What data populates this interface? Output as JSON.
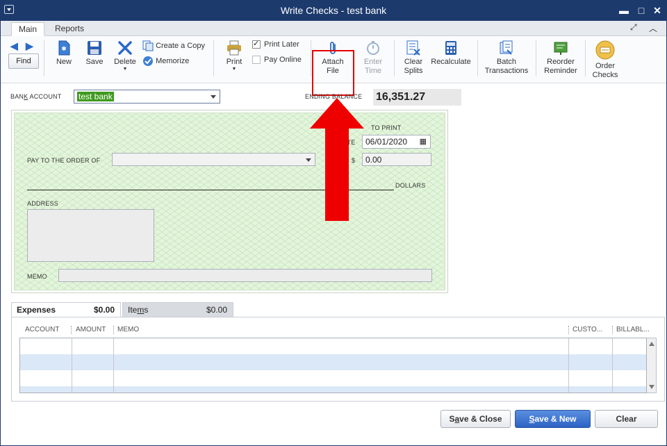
{
  "window": {
    "title": "Write Checks - test bank",
    "controls": {
      "minimize": "▬",
      "maximize": "□",
      "close": "✕"
    }
  },
  "ribbon": {
    "tabs": [
      "Main",
      "Reports"
    ],
    "active_tab": "Main"
  },
  "toolbar": {
    "find": "Find",
    "new": "New",
    "save": "Save",
    "delete": "Delete",
    "create_copy": "Create a Copy",
    "memorize": "Memorize",
    "print": "Print",
    "print_later": "Print Later",
    "print_later_checked": true,
    "pay_online": "Pay Online",
    "pay_online_checked": false,
    "attach_file_line1": "Attach",
    "attach_file_line2": "File",
    "enter_time_line1": "Enter",
    "enter_time_line2": "Time",
    "clear_splits_line1": "Clear",
    "clear_splits_line2": "Splits",
    "recalculate": "Recalculate",
    "batch_line1": "Batch",
    "batch_line2": "Transactions",
    "reorder_line1": "Reorder",
    "reorder_line2": "Reminder",
    "order_checks_line1": "Order",
    "order_checks_line2": "Checks"
  },
  "header": {
    "bank_account_label_pre": "BAN",
    "bank_account_label_u": "K",
    "bank_account_label_post": " ACCOUNT",
    "bank_account_value": "test bank",
    "ending_balance_label": "ENDING BALANCE",
    "ending_balance_value": "16,351.27"
  },
  "check": {
    "no_label": "O.",
    "to_print": "TO PRINT",
    "date_label": "ATE",
    "date_value": "06/01/2020",
    "pay_to_label": "PAY TO THE ORDER OF",
    "pay_to_value": "",
    "dollar_sign": "$",
    "amount_value": "0.00",
    "dollars_label": "DOLLARS",
    "address_label": "ADDRESS",
    "memo_label": "MEMO"
  },
  "detail": {
    "tabs": [
      {
        "name": "Expenses",
        "amount": "$0.00"
      },
      {
        "name_pre": "Ite",
        "name_u": "m",
        "name_post": "s",
        "amount": "$0.00"
      }
    ],
    "columns": [
      "ACCOUNT",
      "AMOUNT",
      "MEMO",
      "CUSTO...",
      "BILLABL..."
    ]
  },
  "buttons": {
    "save_close_pre": "S",
    "save_close_u": "a",
    "save_close_post": "ve & Close",
    "save_new_u": "S",
    "save_new_post": "ave & New",
    "clear": "Clear"
  },
  "colors": {
    "accent_red": "#e60000",
    "titlebar": "#1d3a6d",
    "account_highlight": "#3f9a1f",
    "check_background": "#e4f5dc"
  }
}
